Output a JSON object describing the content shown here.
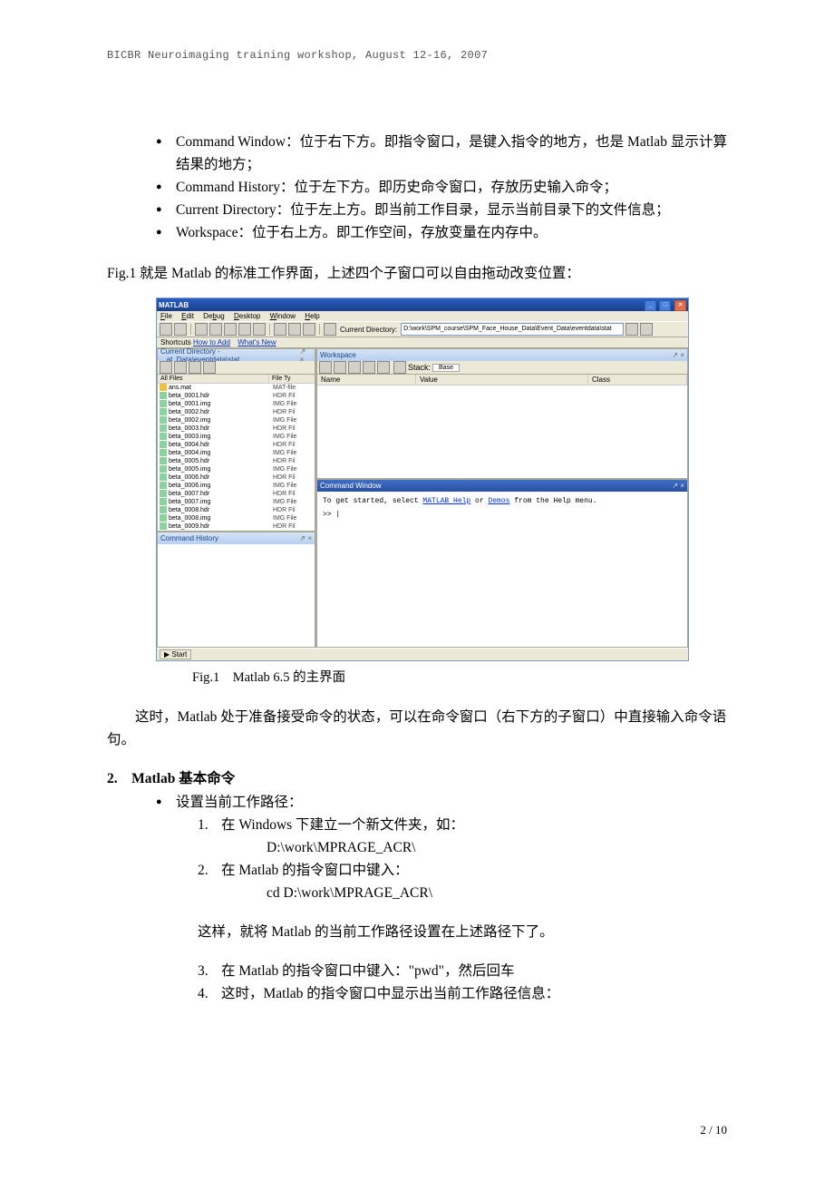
{
  "header": "BICBR Neuroimaging training workshop, August 12-16, 2007",
  "bullets": [
    "Command Window：位于右下方。即指令窗口，是键入指令的地方，也是 Matlab 显示计算结果的地方；",
    "Command History：位于左下方。即历史命令窗口，存放历史输入命令；",
    "Current Directory：位于左上方。即当前工作目录，显示当前目录下的文件信息；",
    "Workspace：位于右上方。即工作空间，存放变量在内存中。"
  ],
  "figline": "Fig.1 就是 Matlab 的标准工作界面，上述四个子窗口可以自由拖动改变位置：",
  "matlab": {
    "title": "MATLAB",
    "menus": [
      "File",
      "Edit",
      "Debug",
      "Desktop",
      "Window",
      "Help"
    ],
    "curdir_label": "Current Directory:",
    "curdir_path": "D:\\work\\SPM_course\\SPM_Face_House_Data\\Event_Data\\eventdata\\stat",
    "shortcuts_label": "Shortcuts",
    "shortcuts": [
      "How to Add",
      "What's New"
    ],
    "curdir_pane": "Current Directory - ...at_Data\\eventdata\\stat",
    "allfiles": "All Files",
    "filetype": "File Ty",
    "files": [
      {
        "n": "ans.mat",
        "t": "MAT-file"
      },
      {
        "n": "beta_0001.hdr",
        "t": "HDR Fil"
      },
      {
        "n": "beta_0001.img",
        "t": "IMG File"
      },
      {
        "n": "beta_0002.hdr",
        "t": "HDR Fil"
      },
      {
        "n": "beta_0002.img",
        "t": "IMG File"
      },
      {
        "n": "beta_0003.hdr",
        "t": "HDR Fil"
      },
      {
        "n": "beta_0003.img",
        "t": "IMG File"
      },
      {
        "n": "beta_0004.hdr",
        "t": "HDR Fil"
      },
      {
        "n": "beta_0004.img",
        "t": "IMG File"
      },
      {
        "n": "beta_0005.hdr",
        "t": "HDR Fil"
      },
      {
        "n": "beta_0005.img",
        "t": "IMG File"
      },
      {
        "n": "beta_0006.hdr",
        "t": "HDR Fil"
      },
      {
        "n": "beta_0006.img",
        "t": "IMG File"
      },
      {
        "n": "beta_0007.hdr",
        "t": "HDR Fil"
      },
      {
        "n": "beta_0007.img",
        "t": "IMG File"
      },
      {
        "n": "beta_0008.hdr",
        "t": "HDR Fil"
      },
      {
        "n": "beta_0008.img",
        "t": "IMG File"
      },
      {
        "n": "beta_0009.hdr",
        "t": "HDR Fil"
      }
    ],
    "history_pane": "Command History",
    "workspace_pane": "Workspace",
    "ws_cols": {
      "name": "Name",
      "value": "Value",
      "class": "Class"
    },
    "ws_stack": "Stack:",
    "ws_base": "Base",
    "cmd_pane": "Command Window",
    "cmd_msg_pre": "To get started, select ",
    "cmd_link1": "MATLAB Help",
    "cmd_mid": " or ",
    "cmd_link2": "Demos",
    "cmd_msg_post": " from the Help menu.",
    "prompt": ">> ",
    "start": "Start"
  },
  "figcap": "Fig.1　Matlab 6.5 的主界面",
  "para1": "这时，Matlab 处于准备接受命令的状态，可以在命令窗口（右下方的子窗口）中直接输入命令语句。",
  "sec2": "2.　Matlab 基本命令",
  "s2b": "设置当前工作路径：",
  "s2_1": "在 Windows 下建立一个新文件夹，如：",
  "s2_1a": "D:\\work\\MPRAGE_ACR\\",
  "s2_2": "在 Matlab 的指令窗口中键入：",
  "s2_2a": "cd D:\\work\\MPRAGE_ACR\\",
  "s2mid": "这样，就将 Matlab 的当前工作路径设置在上述路径下了。",
  "s2_3": "在 Matlab 的指令窗口中键入：\"pwd\"，然后回车",
  "s2_4": "这时，Matlab 的指令窗口中显示出当前工作路径信息：",
  "footer": "2 / 10"
}
